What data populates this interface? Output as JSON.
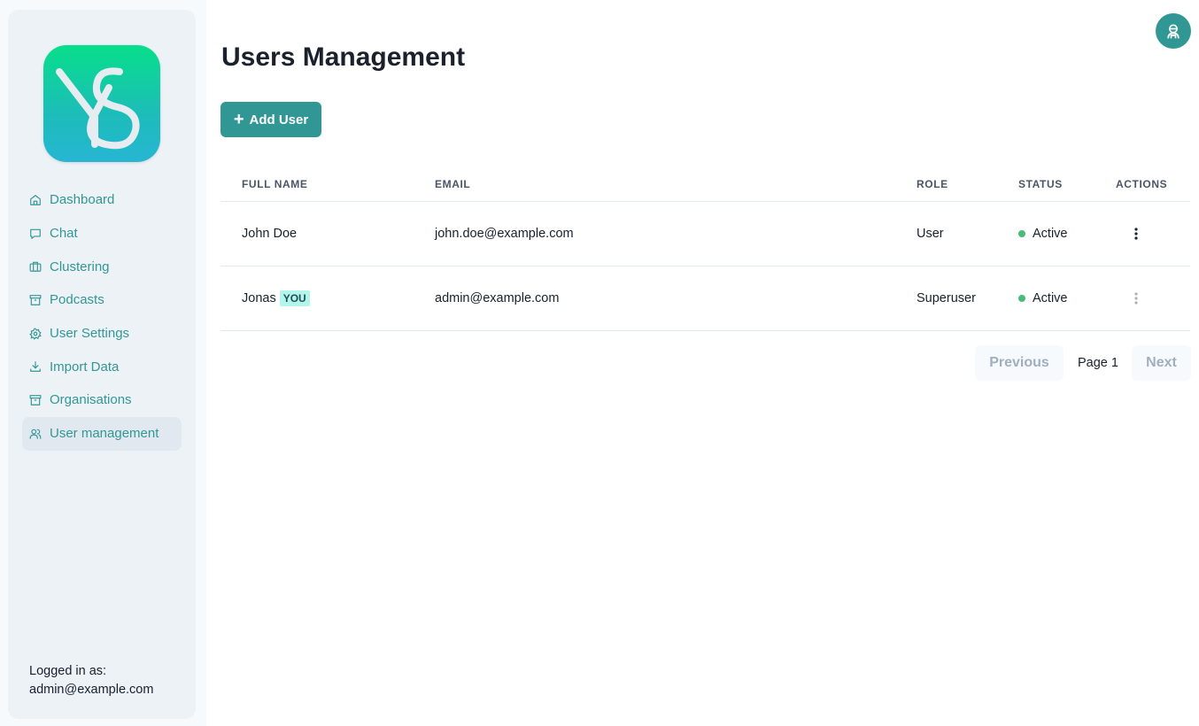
{
  "sidebar": {
    "logo_alt": "YS",
    "items": [
      {
        "label": "Dashboard",
        "icon": "home-icon"
      },
      {
        "label": "Chat",
        "icon": "chat-icon"
      },
      {
        "label": "Clustering",
        "icon": "briefcase-icon"
      },
      {
        "label": "Podcasts",
        "icon": "archive-icon"
      },
      {
        "label": "User Settings",
        "icon": "settings-icon"
      },
      {
        "label": "Import Data",
        "icon": "download-icon"
      },
      {
        "label": "Organisations",
        "icon": "archive-icon"
      },
      {
        "label": "User management",
        "icon": "users-icon",
        "active": true
      }
    ],
    "logged_in_label": "Logged in as:",
    "logged_in_email": "admin@example.com"
  },
  "header": {
    "title": "Users Management",
    "add_user_label": "Add User",
    "avatar_icon": "user-avatar-icon"
  },
  "table": {
    "columns": [
      "Full name",
      "Email",
      "Role",
      "Status",
      "Actions"
    ],
    "rows": [
      {
        "name": "John Doe",
        "badge": "",
        "email": "john.doe@example.com",
        "role": "User",
        "status": "Active",
        "actions_enabled": true
      },
      {
        "name": "Jonas",
        "badge": "YOU",
        "email": "admin@example.com",
        "role": "Superuser",
        "status": "Active",
        "actions_enabled": false
      }
    ]
  },
  "pagination": {
    "prev_label": "Previous",
    "page_label": "Page 1",
    "next_label": "Next"
  },
  "colors": {
    "accent": "#319795",
    "status_active": "#48bb78",
    "sidebar_bg": "#edf2f7"
  }
}
